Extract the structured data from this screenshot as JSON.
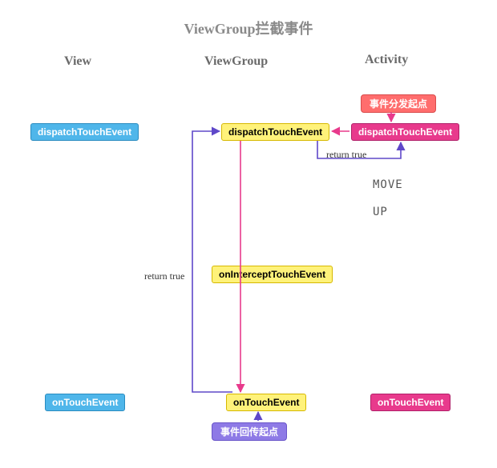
{
  "title": "ViewGroup拦截事件",
  "columns": {
    "view": "View",
    "viewgroup": "ViewGroup",
    "activity": "Activity"
  },
  "pills": {
    "dispatch_start": "事件分发起点",
    "return_start": "事件回传起点"
  },
  "boxes": {
    "view": {
      "dispatch": "dispatchTouchEvent",
      "touch": "onTouchEvent"
    },
    "vg": {
      "dispatch": "dispatchTouchEvent",
      "intercept": "onInterceptTouchEvent",
      "touch": "onTouchEvent"
    },
    "act": {
      "dispatch": "dispatchTouchEvent",
      "touch": "onTouchEvent"
    }
  },
  "edges": {
    "return_true_right": "return true",
    "return_true_left": "return true"
  },
  "state": {
    "move": "MOVE",
    "up": "UP"
  }
}
